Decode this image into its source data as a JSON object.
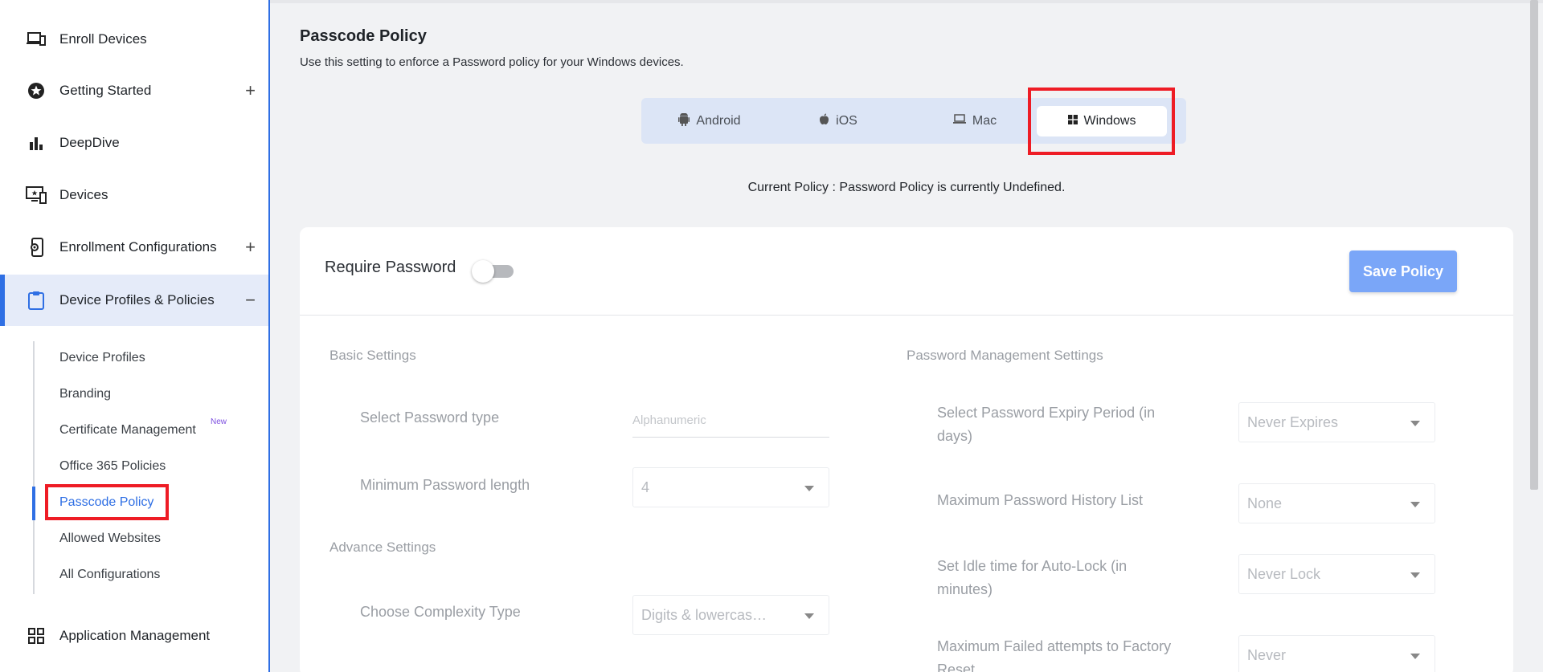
{
  "sidebar": {
    "items": [
      {
        "label": "Enroll Devices",
        "icon": "devices-icon"
      },
      {
        "label": "Getting Started",
        "icon": "star-badge-icon",
        "expand": "+"
      },
      {
        "label": "DeepDive",
        "icon": "bar-chart-icon"
      },
      {
        "label": "Devices",
        "icon": "monitor-icon"
      },
      {
        "label": "Enrollment Configurations",
        "icon": "phone-settings-icon",
        "expand": "+"
      },
      {
        "label": "Device Profiles & Policies",
        "icon": "clipboard-icon",
        "expand": "−"
      }
    ],
    "sub_items": [
      "Device Profiles",
      "Branding",
      "Certificate Management",
      "Office 365 Policies",
      "Passcode Policy",
      "Allowed Websites",
      "All Configurations"
    ],
    "new_badge": "New",
    "bottom_item": {
      "label": "Application Management",
      "icon": "grid-icon"
    }
  },
  "main": {
    "title": "Passcode Policy",
    "description": "Use this setting to enforce a Password policy for your Windows devices.",
    "os_tabs": [
      {
        "label": "Android",
        "icon": "android-icon"
      },
      {
        "label": "iOS",
        "icon": "apple-icon"
      },
      {
        "label": "Mac",
        "icon": "laptop-icon"
      },
      {
        "label": "Windows",
        "icon": "windows-icon",
        "selected": true
      }
    ],
    "current_policy": "Current Policy : Password Policy is currently Undefined.",
    "require_password": {
      "label": "Require Password",
      "enabled": false
    },
    "save_button": "Save Policy",
    "basic_settings": {
      "title": "Basic Settings",
      "password_type_label": "Select Password type",
      "password_type_value": "Alphanumeric",
      "min_length_label": "Minimum Password length",
      "min_length_value": "4"
    },
    "advance_settings": {
      "title": "Advance Settings",
      "complexity_label": "Choose Complexity Type",
      "complexity_value": "Digits & lowercas…"
    },
    "password_management": {
      "title": "Password Management Settings",
      "expiry_label": "Select Password Expiry Period (in days)",
      "expiry_value": "Never Expires",
      "history_label": "Maximum Password History List",
      "history_value": "None",
      "idle_label": "Set Idle time for Auto-Lock (in minutes)",
      "idle_value": "Never Lock",
      "failed_label": "Maximum Failed attempts to Factory Reset",
      "failed_value": "Never"
    }
  },
  "colors": {
    "accent": "#2f6fe4",
    "highlight": "#ee1c25",
    "save_button": "#7aa6f8"
  }
}
